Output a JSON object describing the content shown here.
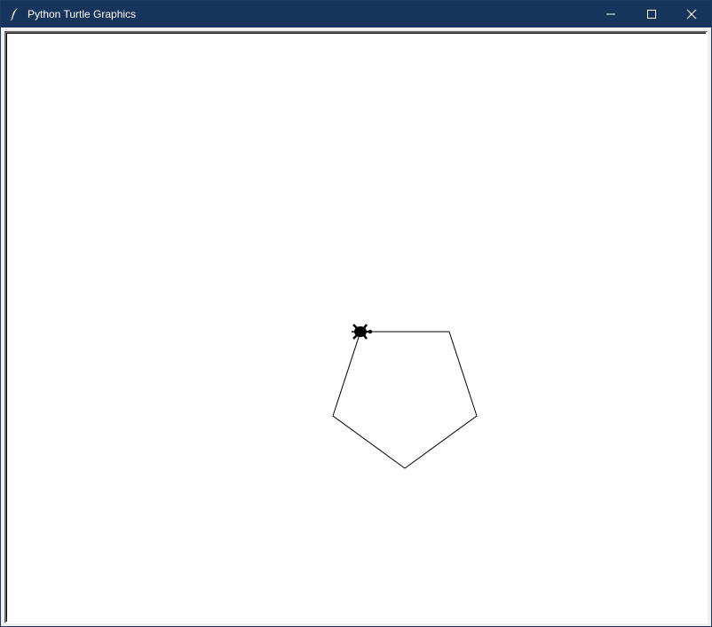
{
  "window": {
    "title": "Python Turtle Graphics",
    "titlebar_color": "#17345c",
    "controls": {
      "minimize": "minimize-icon",
      "maximize": "maximize-icon",
      "close": "close-icon"
    }
  },
  "canvas": {
    "background": "#ffffff",
    "pen_color": "#000000",
    "shape": "pentagon",
    "turtle_icon": "turtle-icon"
  }
}
